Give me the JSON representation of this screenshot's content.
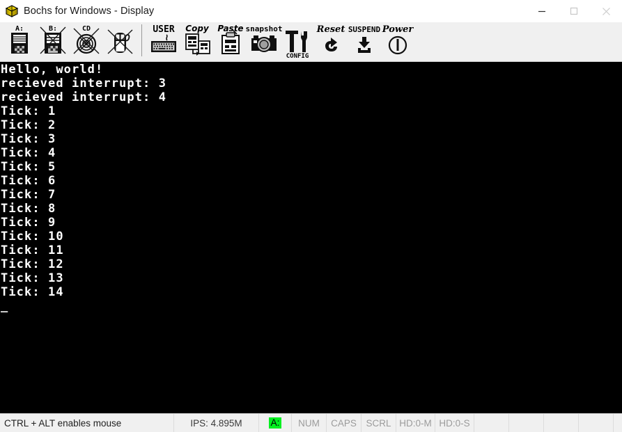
{
  "window": {
    "title": "Bochs for Windows - Display",
    "icon": "bochs-box-icon",
    "controls": [
      {
        "name": "minimize-button",
        "glyph": "minimize-icon"
      },
      {
        "name": "maximize-button",
        "glyph": "maximize-icon"
      },
      {
        "name": "close-button",
        "glyph": "close-icon"
      }
    ]
  },
  "toolbar": {
    "items": [
      {
        "name": "floppy-a-button",
        "label": "A:",
        "icon": "floppy-a-icon"
      },
      {
        "name": "floppy-b-button",
        "label": "B:",
        "icon": "floppy-b-icon"
      },
      {
        "name": "cdrom-button",
        "label": "CD",
        "icon": "cdrom-icon"
      },
      {
        "name": "mouse-button",
        "label": "",
        "icon": "mouse-disabled-icon"
      },
      {
        "name": "user-button",
        "label": "USER",
        "icon": "keyboard-icon"
      },
      {
        "name": "copy-button",
        "label": "Copy",
        "icon": "copy-icon"
      },
      {
        "name": "paste-button",
        "label": "Paste",
        "icon": "paste-icon"
      },
      {
        "name": "snapshot-button",
        "label": "snapshot",
        "icon": "camera-icon"
      },
      {
        "name": "config-button",
        "label": "CONFIG",
        "icon": "tools-icon"
      },
      {
        "name": "reset-button",
        "label": "Reset",
        "icon": "reset-arrow-icon"
      },
      {
        "name": "suspend-button",
        "label": "SUSPEND",
        "icon": "suspend-icon"
      },
      {
        "name": "power-button",
        "label": "Power",
        "icon": "power-icon"
      }
    ]
  },
  "display": {
    "lines": [
      "Hello, world!",
      "recieved interrupt: 3",
      "recieved interrupt: 4",
      "Tick: 1",
      "Tick: 2",
      "Tick: 3",
      "Tick: 4",
      "Tick: 5",
      "Tick: 6",
      "Tick: 7",
      "Tick: 8",
      "Tick: 9",
      "Tick: 10",
      "Tick: 11",
      "Tick: 12",
      "Tick: 13",
      "Tick: 14"
    ],
    "cursor": "_",
    "background_color": "#000000",
    "text_color": "#ffffff"
  },
  "statusbar": {
    "message": "CTRL + ALT enables mouse",
    "ips": "IPS: 4.895M",
    "floppy_led": "A:",
    "floppy_led_color": "#00f020",
    "num_lock": "NUM",
    "caps_lock": "CAPS",
    "scroll_lock": "SCRL",
    "hd_master": "HD:0-M",
    "hd_slave": "HD:0-S"
  }
}
